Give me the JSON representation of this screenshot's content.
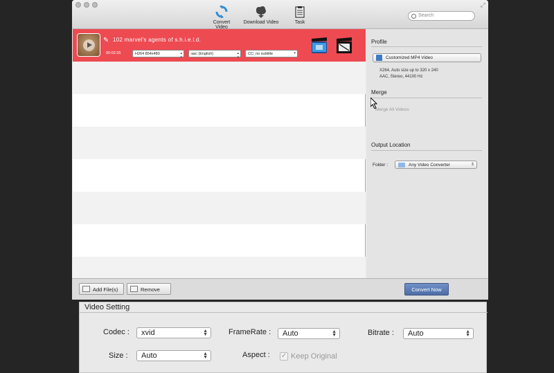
{
  "toolbar": {
    "convert_video": "Convert Video",
    "download_video": "Download Video",
    "task": "Task",
    "search_placeholder": "Search"
  },
  "file_row": {
    "name": "102 marvel's agents of s.h.i.e.l.d.",
    "duration": "00:02:35",
    "video_track": "H264 854x480",
    "audio_track": "aac (English)",
    "subtitle": "CC: no subtitle"
  },
  "side": {
    "profile_heading": "Profile",
    "profile_button": "Customized MP4 Video",
    "profile_desc_1": "X264, Auto size up to 320 x 240",
    "profile_desc_2": "AAC, Stereo, 44100 Hz",
    "merge_heading": "Merge",
    "merge_label": "Merge All Videos",
    "output_heading": "Output Location",
    "folder_label": "Folder :",
    "folder_value": "Any Video Converter"
  },
  "bottom": {
    "add_files": "Add File(s)",
    "remove": "Remove",
    "convert_now": "Convert Now"
  },
  "video_setting": {
    "title": "Video Setting",
    "codec_label": "Codec :",
    "codec_value": "xvid",
    "framerate_label": "FrameRate :",
    "framerate_value": "Auto",
    "bitrate_label": "Bitrate :",
    "bitrate_value": "Auto",
    "size_label": "Size :",
    "size_value": "Auto",
    "aspect_label": "Aspect :",
    "keep_original": "Keep Original"
  },
  "colors": {
    "selected_row": "#ee4a52",
    "convert_button": "#5a78b2",
    "icon_blue": "#2f8fd8"
  }
}
